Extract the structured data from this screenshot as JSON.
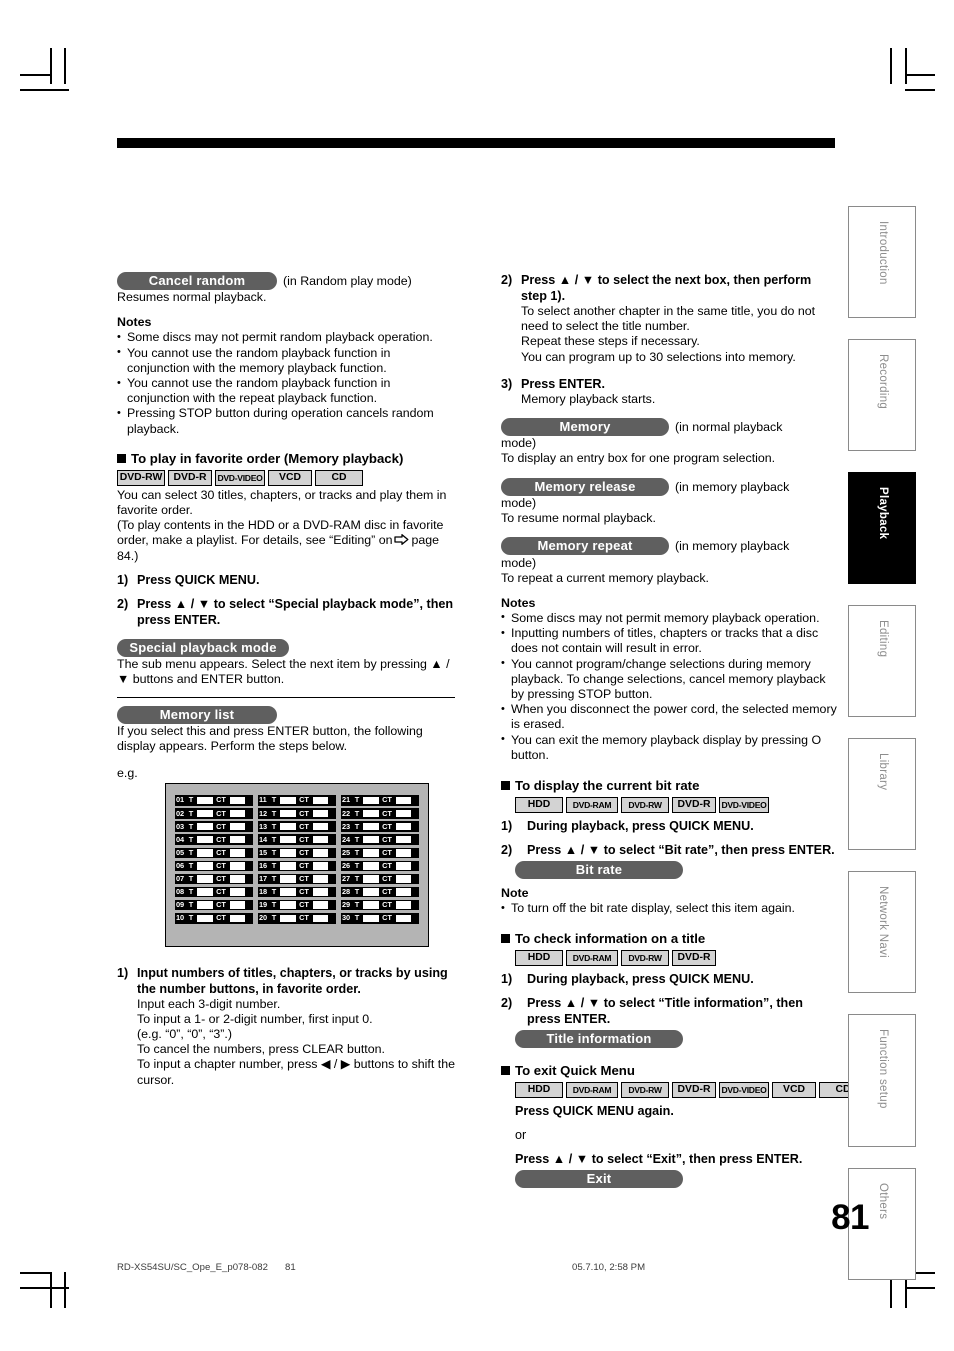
{
  "page": {
    "number": "81",
    "footer": {
      "file": "RD-XS54SU/SC_Ope_E_p078-082",
      "page": "81",
      "date": "05.7.10, 2:58 PM"
    }
  },
  "side_tabs": [
    {
      "label": "Introduction",
      "active": false
    },
    {
      "label": "Recording",
      "active": false
    },
    {
      "label": "Playback",
      "active": true
    },
    {
      "label": "Editing",
      "active": false
    },
    {
      "label": "Library",
      "active": false
    },
    {
      "label": "Network Navi",
      "active": false
    },
    {
      "label": "Function setup",
      "active": false
    },
    {
      "label": "Others",
      "active": false
    }
  ],
  "left_column": {
    "cancel_random": {
      "pill": "Cancel random",
      "mode_note": "(in Random play mode)",
      "description": "Resumes normal playback."
    },
    "notes_1": {
      "title": "Notes",
      "items": [
        "Some discs may not permit random playback operation.",
        "You cannot use the random playback function in conjunction with the memory playback function.",
        "You cannot use the random playback function in conjunction with the repeat playback function.",
        "Pressing STOP button during operation cancels random playback."
      ]
    },
    "memory_playback": {
      "heading": "To play in favorite order (Memory playback)",
      "chips": [
        "DVD-RW",
        "DVD-R",
        "DVD-VIDEO",
        "VCD",
        "CD"
      ],
      "intro_1": "You can select 30 titles, chapters, or tracks and play them in favorite order.",
      "intro_2a": "(To play contents in the HDD or a DVD-RAM disc in favorite order, make a playlist. For details, see “Editing” on",
      "intro_2b": "page 84.)",
      "step1_num": "1)",
      "step1_text": "Press QUICK MENU.",
      "step2_num": "2)",
      "step2_text": "Press ▲ / ▼ to select “Special playback mode”, then press ENTER.",
      "special_pill": "Special playback mode",
      "special_desc": "The sub menu appears. Select the next item by pressing ▲ / ▼ buttons and ENTER button.",
      "memlist_pill": "Memory list",
      "memlist_desc": "If you select this and press ENTER button, the following display appears. Perform the steps below.",
      "eg_label": "e.g.",
      "memory_list_screen": {
        "rows_per_column": 10,
        "columns": 3,
        "total_entries": 30,
        "t_label": "T",
        "ct_label": "CT",
        "entries": [
          "01",
          "02",
          "03",
          "04",
          "05",
          "06",
          "07",
          "08",
          "09",
          "10",
          "11",
          "12",
          "13",
          "14",
          "15",
          "16",
          "17",
          "18",
          "19",
          "20",
          "21",
          "22",
          "23",
          "24",
          "25",
          "26",
          "27",
          "28",
          "29",
          "30"
        ]
      },
      "input_step_num": "1)",
      "input_step_bold": "Input numbers of titles, chapters, or tracks by using the number buttons, in favorite order.",
      "input_lines": [
        "Input each 3-digit number.",
        "To input a 1- or 2-digit number, first input 0.",
        " (e.g. “0”, “0”, “3”.)",
        "To cancel the numbers, press CLEAR button.",
        "To input a chapter number, press ◀ / ▶ buttons to shift the cursor."
      ]
    }
  },
  "right_column": {
    "step2_num": "2)",
    "step2_bold": "Press ▲ / ▼ to select the next box, then perform step 1).",
    "step2_lines": [
      "To select another chapter in the same title, you do not need to select the title number.",
      "Repeat these steps if necessary.",
      "You can program up to 30 selections into memory."
    ],
    "step3_num": "3)",
    "step3_bold": "Press ENTER.",
    "step3_line": "Memory playback starts.",
    "memory": {
      "pill": "Memory",
      "mode_note_a": "(in normal playback",
      "mode_note_b": "mode)",
      "desc": "To display an entry box for one program selection."
    },
    "memory_release": {
      "pill": "Memory release",
      "mode_note_a": "(in memory playback",
      "mode_note_b": "mode)",
      "desc": "To resume normal playback."
    },
    "memory_repeat": {
      "pill": "Memory repeat",
      "mode_note_a": "(in memory playback",
      "mode_note_b": "mode)",
      "desc": "To repeat a current memory playback."
    },
    "notes_2": {
      "title": "Notes",
      "items": [
        "Some discs may not permit memory playback operation.",
        "Inputting numbers of titles, chapters or tracks that a disc does not contain will result in error.",
        "You cannot program/change selections during memory playback. To change selections, cancel memory playback by pressing STOP button.",
        "When you disconnect the power cord, the selected memory is erased.",
        "You can exit the memory playback display by pressing O button."
      ]
    },
    "bit_rate": {
      "heading": "To display the current bit rate",
      "chips": [
        "HDD",
        "DVD-RAM",
        "DVD-RW",
        "DVD-R",
        "DVD-VIDEO"
      ],
      "step1_num": "1)",
      "step1_text": "During playback, press QUICK MENU.",
      "step2_num": "2)",
      "step2_text": "Press ▲ / ▼ to select “Bit rate”, then press ENTER.",
      "pill": "Bit rate",
      "note_title": "Note",
      "note_item": "To turn off the bit rate display, select this item again."
    },
    "title_info": {
      "heading": "To check information on a title",
      "chips": [
        "HDD",
        "DVD-RAM",
        "DVD-RW",
        "DVD-R"
      ],
      "step1_num": "1)",
      "step1_text": "During playback, press QUICK MENU.",
      "step2_num": "2)",
      "step2_text": "Press ▲ / ▼ to select “Title information”, then press ENTER.",
      "pill": "Title information"
    },
    "exit_quick_menu": {
      "heading": "To exit Quick Menu",
      "chips": [
        "HDD",
        "DVD-RAM",
        "DVD-RW",
        "DVD-R",
        "DVD-VIDEO",
        "VCD",
        "CD"
      ],
      "line1": "Press QUICK MENU again.",
      "or": "or",
      "line2": "Press ▲ / ▼ to select “Exit”, then press ENTER.",
      "pill": "Exit"
    }
  }
}
